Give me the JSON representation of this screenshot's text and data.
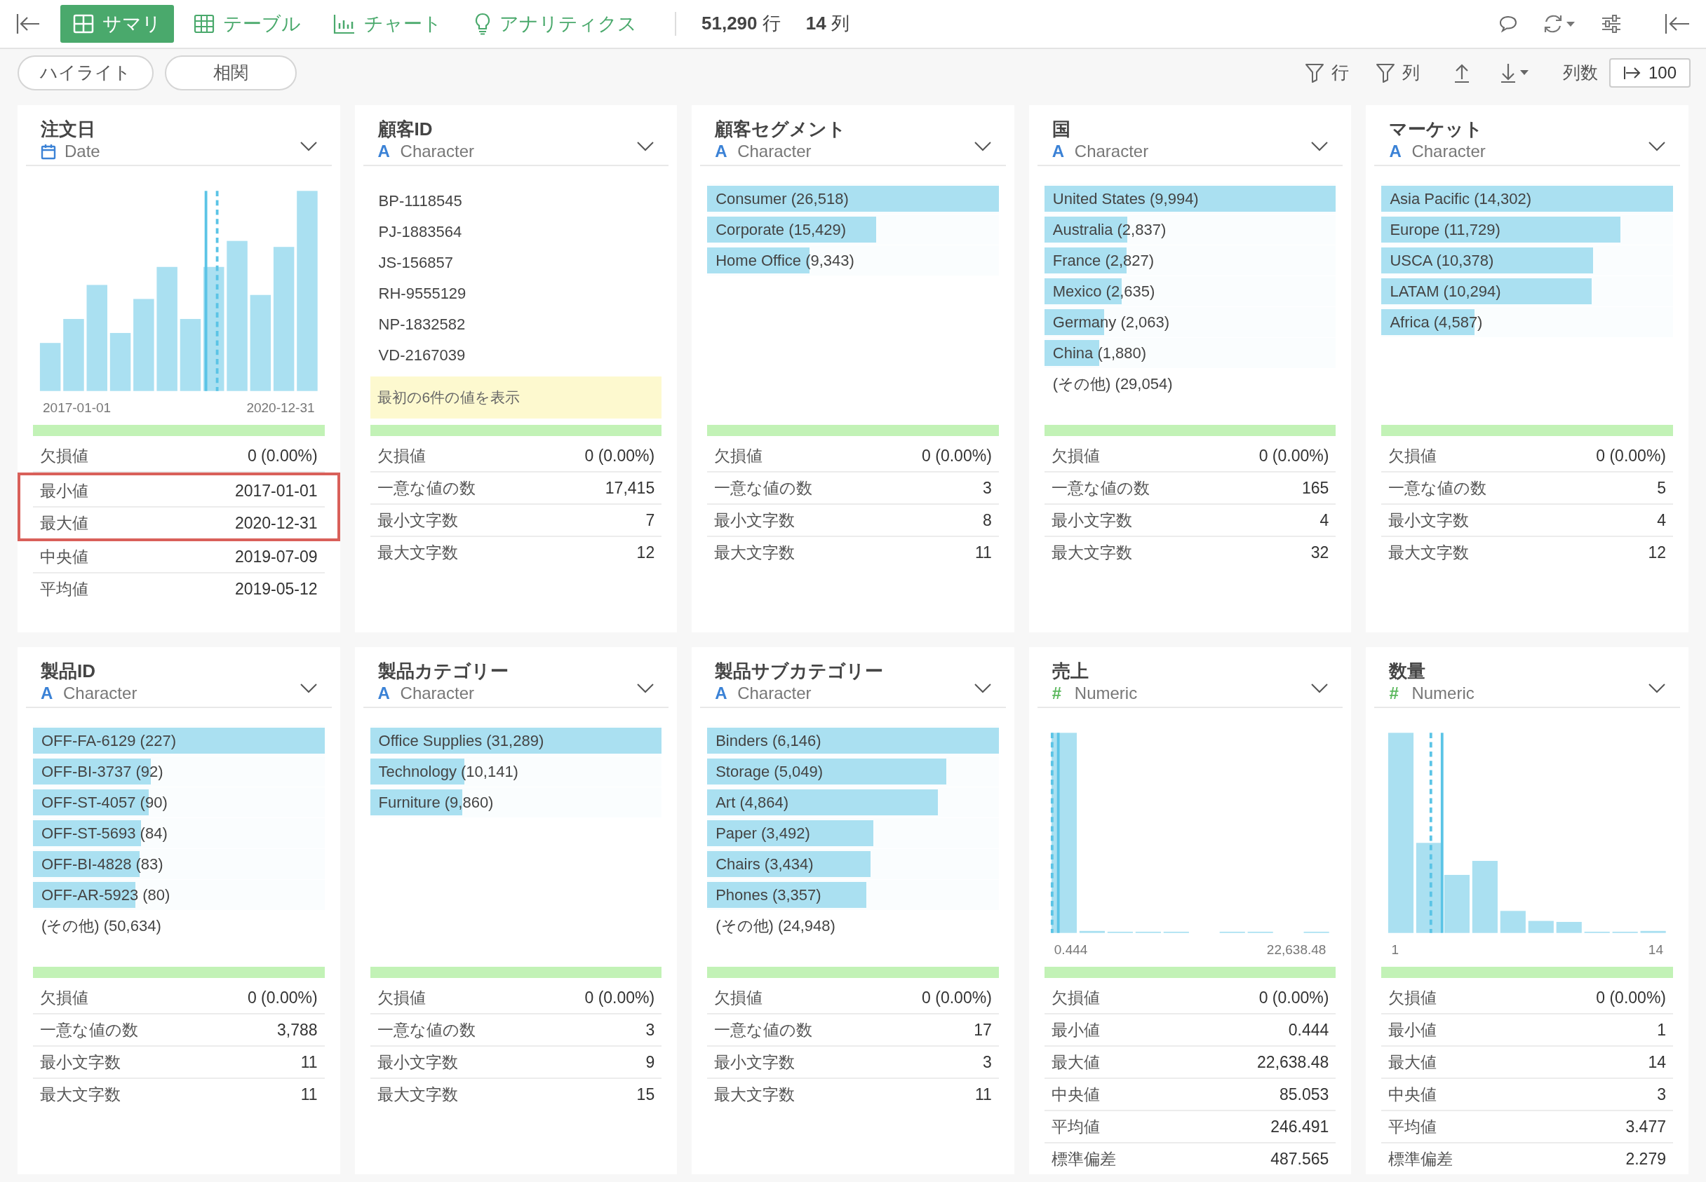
{
  "toolbar": {
    "tabs": [
      {
        "kind": "summary",
        "label": "サマリ",
        "selected": true
      },
      {
        "kind": "table",
        "label": "テーブル",
        "selected": false
      },
      {
        "kind": "chart",
        "label": "チャート",
        "selected": false
      },
      {
        "kind": "analytics",
        "label": "アナリティクス",
        "selected": false
      }
    ],
    "row_count": "51,290",
    "row_unit": "行",
    "column_count": "14",
    "column_unit": "列"
  },
  "subbar": {
    "buttons": [
      "ハイライト",
      "相関"
    ],
    "filter_rows": "行",
    "filter_columns": "列",
    "column_count_label": "列数",
    "column_count_value": "100"
  },
  "cards": [
    {
      "title": "注文日",
      "type": {
        "kind": "date",
        "label": "Date"
      },
      "content": {
        "kind": "histogram",
        "x_min": "2017-01-01",
        "x_max": "2020-12-31"
      },
      "stats": [
        {
          "label": "欠損値",
          "value": "0 (0.00%)",
          "highlighted": false
        },
        {
          "label": "最小値",
          "value": "2017-01-01",
          "highlighted": true
        },
        {
          "label": "最大値",
          "value": "2020-12-31",
          "highlighted": true
        },
        {
          "label": "中央値",
          "value": "2019-07-09",
          "highlighted": false
        },
        {
          "label": "平均値",
          "value": "2019-05-12",
          "highlighted": false
        }
      ]
    },
    {
      "title": "顧客ID",
      "type": {
        "kind": "character",
        "icon": "A",
        "label": "Character"
      },
      "content": {
        "kind": "values",
        "values": [
          "BP-1118545",
          "PJ-1883564",
          "JS-156857",
          "RH-9555129",
          "NP-1832582",
          "VD-2167039"
        ],
        "note": "最初の6件の値を表示"
      },
      "stats": [
        {
          "label": "欠損値",
          "value": "0 (0.00%)",
          "highlighted": false
        },
        {
          "label": "一意な値の数",
          "value": "17,415",
          "highlighted": false
        },
        {
          "label": "最小文字数",
          "value": "7",
          "highlighted": false
        },
        {
          "label": "最大文字数",
          "value": "12",
          "highlighted": false
        }
      ]
    },
    {
      "title": "顧客セグメント",
      "type": {
        "kind": "character",
        "icon": "A",
        "label": "Character"
      },
      "content": {
        "kind": "bars",
        "items": [
          {
            "label": "Consumer (26,518)",
            "level": 1
          },
          {
            "label": "Corporate (15,429)",
            "level": 0.58
          },
          {
            "label": "Home Office (9,343)",
            "level": 0.35
          }
        ]
      },
      "stats": [
        {
          "label": "欠損値",
          "value": "0 (0.00%)",
          "highlighted": false
        },
        {
          "label": "一意な値の数",
          "value": "3",
          "highlighted": false
        },
        {
          "label": "最小文字数",
          "value": "8",
          "highlighted": false
        },
        {
          "label": "最大文字数",
          "value": "11",
          "highlighted": false
        }
      ]
    },
    {
      "title": "国",
      "type": {
        "kind": "character",
        "icon": "A",
        "label": "Character"
      },
      "content": {
        "kind": "bars",
        "items": [
          {
            "label": "United States (9,994)",
            "level": 1
          },
          {
            "label": "Australia (2,837)",
            "level": 0.284
          },
          {
            "label": "France (2,827)",
            "level": 0.283
          },
          {
            "label": "Mexico (2,635)",
            "level": 0.264
          },
          {
            "label": "Germany (2,063)",
            "level": 0.206
          },
          {
            "label": "China (1,880)",
            "level": 0.188
          }
        ],
        "other": "(その他) (29,054)"
      },
      "stats": [
        {
          "label": "欠損値",
          "value": "0 (0.00%)",
          "highlighted": false
        },
        {
          "label": "一意な値の数",
          "value": "165",
          "highlighted": false
        },
        {
          "label": "最小文字数",
          "value": "4",
          "highlighted": false
        },
        {
          "label": "最大文字数",
          "value": "32",
          "highlighted": false
        }
      ]
    },
    {
      "title": "マーケット",
      "type": {
        "kind": "character",
        "icon": "A",
        "label": "Character"
      },
      "content": {
        "kind": "bars",
        "items": [
          {
            "label": "Asia Pacific (14,302)",
            "level": 1
          },
          {
            "label": "Europe (11,729)",
            "level": 0.82
          },
          {
            "label": "USCA (10,378)",
            "level": 0.726
          },
          {
            "label": "LATAM (10,294)",
            "level": 0.72
          },
          {
            "label": "Africa (4,587)",
            "level": 0.32
          }
        ]
      },
      "stats": [
        {
          "label": "欠損値",
          "value": "0 (0.00%)",
          "highlighted": false
        },
        {
          "label": "一意な値の数",
          "value": "5",
          "highlighted": false
        },
        {
          "label": "最小文字数",
          "value": "4",
          "highlighted": false
        },
        {
          "label": "最大文字数",
          "value": "12",
          "highlighted": false
        }
      ]
    },
    {
      "title": "製品ID",
      "type": {
        "kind": "character",
        "icon": "A",
        "label": "Character"
      },
      "content": {
        "kind": "bars",
        "items": [
          {
            "label": "OFF-FA-6129 (227)",
            "level": 1
          },
          {
            "label": "OFF-BI-3737 (92)",
            "level": 0.405
          },
          {
            "label": "OFF-ST-4057 (90)",
            "level": 0.396
          },
          {
            "label": "OFF-ST-5693 (84)",
            "level": 0.37
          },
          {
            "label": "OFF-BI-4828 (83)",
            "level": 0.366
          },
          {
            "label": "OFF-AR-5923 (80)",
            "level": 0.352
          }
        ],
        "other": "(その他) (50,634)"
      },
      "stats": [
        {
          "label": "欠損値",
          "value": "0 (0.00%)",
          "highlighted": false
        },
        {
          "label": "一意な値の数",
          "value": "3,788",
          "highlighted": false
        },
        {
          "label": "最小文字数",
          "value": "11",
          "highlighted": false
        },
        {
          "label": "最大文字数",
          "value": "11",
          "highlighted": false
        }
      ]
    },
    {
      "title": "製品カテゴリー",
      "type": {
        "kind": "character",
        "icon": "A",
        "label": "Character"
      },
      "content": {
        "kind": "bars",
        "items": [
          {
            "label": "Office Supplies (31,289)",
            "level": 1
          },
          {
            "label": "Technology (10,141)",
            "level": 0.324
          },
          {
            "label": "Furniture (9,860)",
            "level": 0.315
          }
        ]
      },
      "stats": [
        {
          "label": "欠損値",
          "value": "0 (0.00%)",
          "highlighted": false
        },
        {
          "label": "一意な値の数",
          "value": "3",
          "highlighted": false
        },
        {
          "label": "最小文字数",
          "value": "9",
          "highlighted": false
        },
        {
          "label": "最大文字数",
          "value": "15",
          "highlighted": false
        }
      ]
    },
    {
      "title": "製品サブカテゴリー",
      "type": {
        "kind": "character",
        "icon": "A",
        "label": "Character"
      },
      "content": {
        "kind": "bars",
        "items": [
          {
            "label": "Binders (6,146)",
            "level": 1
          },
          {
            "label": "Storage (5,049)",
            "level": 0.82
          },
          {
            "label": "Art (4,864)",
            "level": 0.79
          },
          {
            "label": "Paper (3,492)",
            "level": 0.57
          },
          {
            "label": "Chairs (3,434)",
            "level": 0.56
          },
          {
            "label": "Phones (3,357)",
            "level": 0.546
          }
        ],
        "other": "(その他) (24,948)"
      },
      "stats": [
        {
          "label": "欠損値",
          "value": "0 (0.00%)",
          "highlighted": false
        },
        {
          "label": "一意な値の数",
          "value": "17",
          "highlighted": false
        },
        {
          "label": "最小文字数",
          "value": "3",
          "highlighted": false
        },
        {
          "label": "最大文字数",
          "value": "11",
          "highlighted": false
        }
      ]
    },
    {
      "title": "売上",
      "type": {
        "kind": "numeric",
        "icon": "#",
        "label": "Numeric"
      },
      "content": {
        "kind": "histogram",
        "x_min": "0.444",
        "x_max": "22,638.48"
      },
      "stats": [
        {
          "label": "欠損値",
          "value": "0 (0.00%)",
          "highlighted": false
        },
        {
          "label": "最小値",
          "value": "0.444",
          "highlighted": false
        },
        {
          "label": "最大値",
          "value": "22,638.48",
          "highlighted": false
        },
        {
          "label": "中央値",
          "value": "85.053",
          "highlighted": false
        },
        {
          "label": "平均値",
          "value": "246.491",
          "highlighted": false
        },
        {
          "label": "標準偏差",
          "value": "487.565",
          "highlighted": false
        }
      ]
    },
    {
      "title": "数量",
      "type": {
        "kind": "numeric",
        "icon": "#",
        "label": "Numeric"
      },
      "content": {
        "kind": "histogram",
        "x_min": "1",
        "x_max": "14"
      },
      "stats": [
        {
          "label": "欠損値",
          "value": "0 (0.00%)",
          "highlighted": false
        },
        {
          "label": "最小値",
          "value": "1",
          "highlighted": false
        },
        {
          "label": "最大値",
          "value": "14",
          "highlighted": false
        },
        {
          "label": "中央値",
          "value": "3",
          "highlighted": false
        },
        {
          "label": "平均値",
          "value": "3.477",
          "highlighted": false
        },
        {
          "label": "標準偏差",
          "value": "2.279",
          "highlighted": false
        }
      ]
    }
  ]
}
